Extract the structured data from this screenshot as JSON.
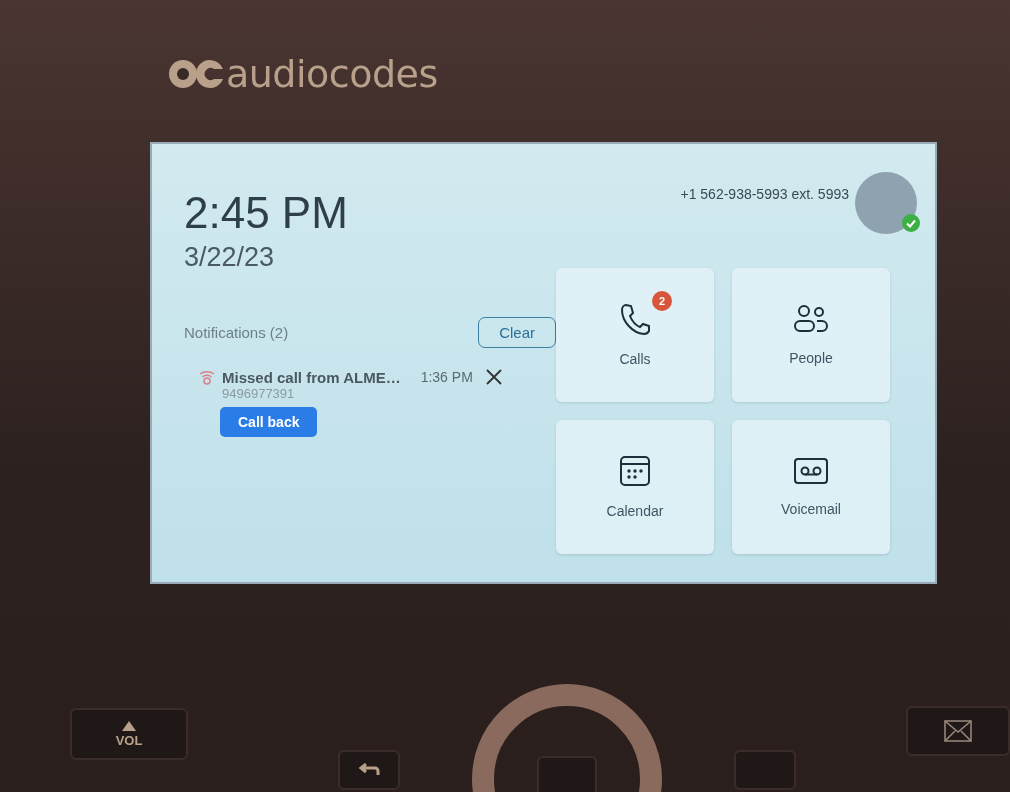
{
  "device": {
    "brand": "audiocodes"
  },
  "screen": {
    "time": "2:45 PM",
    "date": "3/22/23",
    "account": {
      "number": "+1 562-938-5993 ext. 5993",
      "online": true
    },
    "notifications": {
      "title": "Notifications (2)",
      "clear_button": "Clear",
      "items": [
        {
          "kind": "missed_call",
          "text": "Missed call from ALME…",
          "time": "1:36 PM",
          "number": "9496977391",
          "action": "Call back"
        }
      ]
    },
    "tiles": [
      {
        "kind": "calls",
        "label": "Calls",
        "badge": "2"
      },
      {
        "kind": "people",
        "label": "People"
      },
      {
        "kind": "calendar",
        "label": "Calendar"
      },
      {
        "kind": "voicemail",
        "label": "Voicemail"
      }
    ]
  },
  "keys": [
    {
      "kind": "volume",
      "label": "VOL"
    },
    {
      "kind": "back"
    },
    {
      "kind": "ok"
    },
    {
      "kind": "menu"
    },
    {
      "kind": "mail"
    }
  ]
}
